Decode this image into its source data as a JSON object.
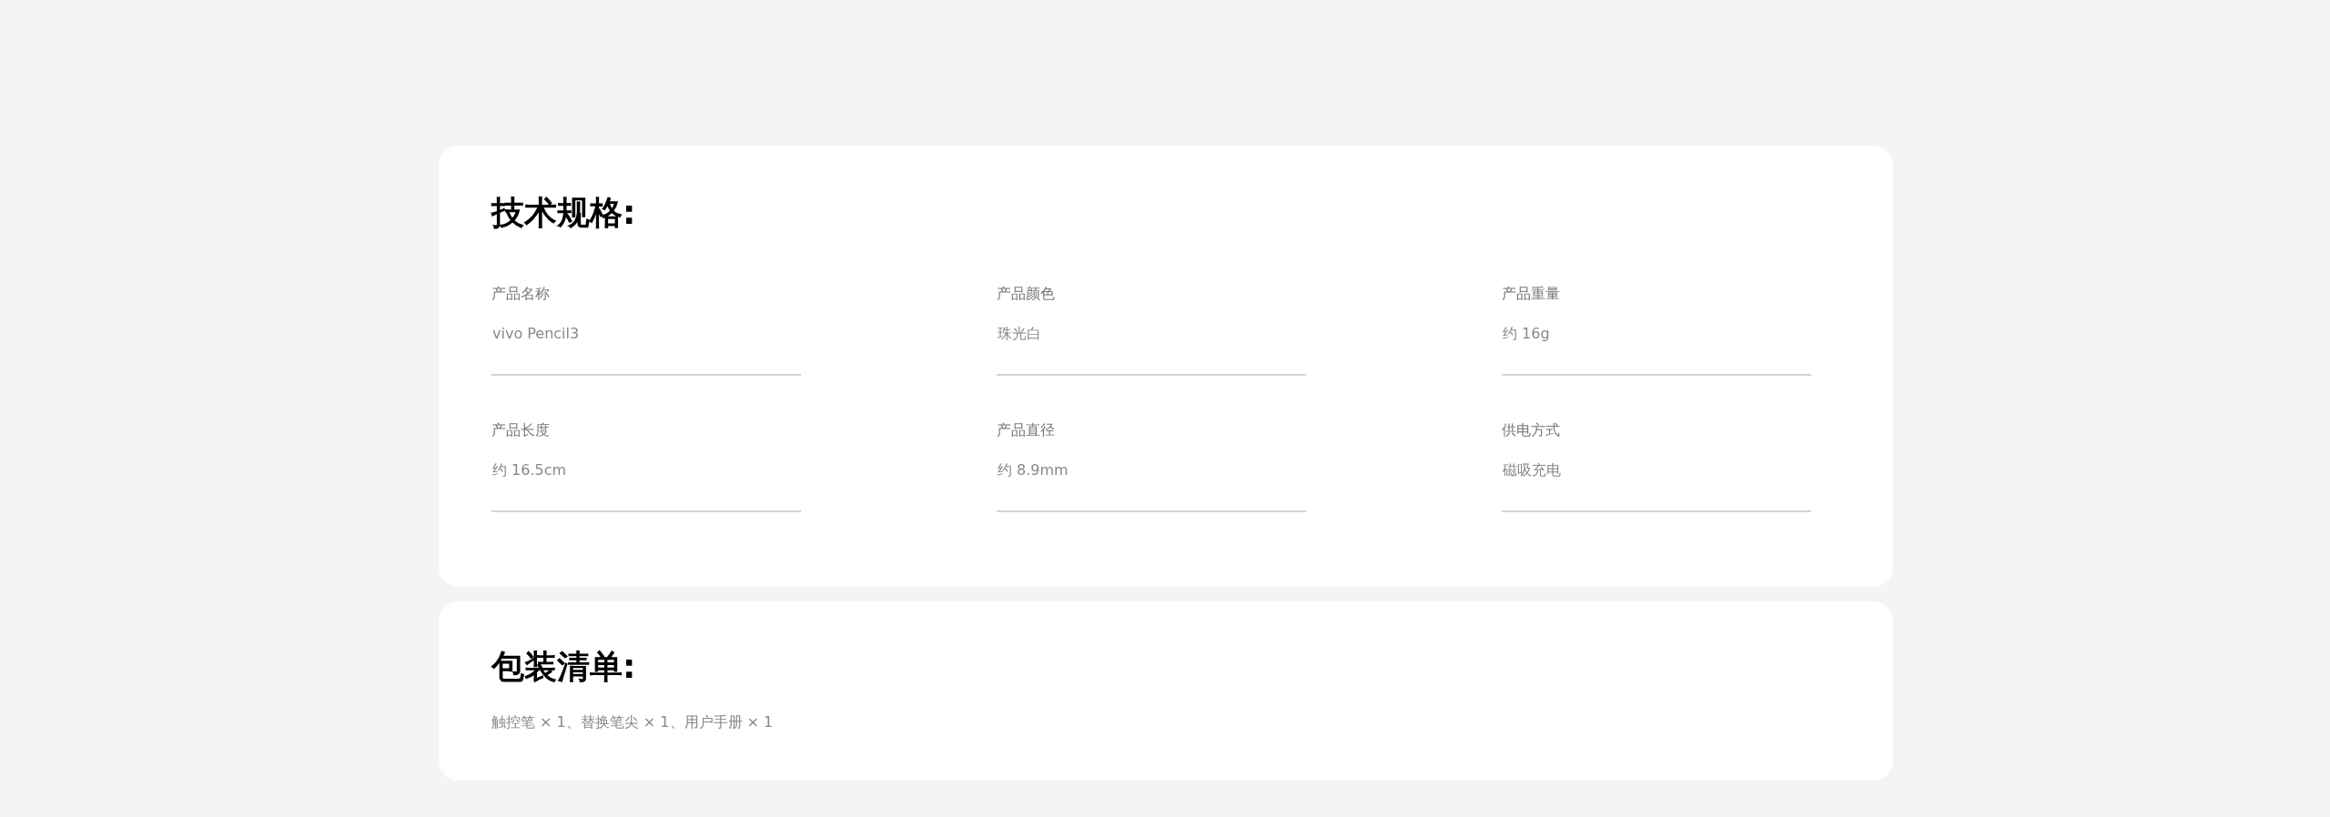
{
  "specs": {
    "title": "技术规格:",
    "items": [
      {
        "label": "产品名称",
        "value": "vivo Pencil3"
      },
      {
        "label": "产品颜色",
        "value": "珠光白"
      },
      {
        "label": "产品重量",
        "value": "约 16g"
      },
      {
        "label": "产品长度",
        "value": "约 16.5cm"
      },
      {
        "label": "产品直径",
        "value": "约 8.9mm"
      },
      {
        "label": "供电方式",
        "value": "磁吸充电"
      }
    ]
  },
  "package": {
    "title": "包装清单:",
    "contents": "触控笔 × 1、替换笔尖 × 1、用户手册 × 1"
  }
}
